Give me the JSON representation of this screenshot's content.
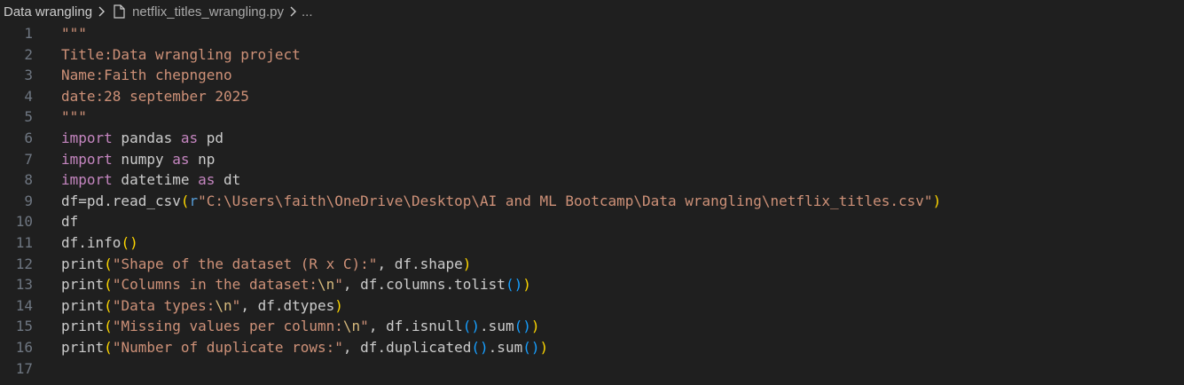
{
  "breadcrumb": {
    "folder": "Data wrangling",
    "file": "netflix_titles_wrangling.py",
    "more": "..."
  },
  "editor": {
    "lines": [
      {
        "num": "1",
        "tokens": [
          {
            "t": "\"\"\"",
            "c": "str"
          }
        ]
      },
      {
        "num": "2",
        "tokens": [
          {
            "t": "Title:Data wrangling project",
            "c": "str"
          }
        ]
      },
      {
        "num": "3",
        "tokens": [
          {
            "t": "Name:Faith chepngeno",
            "c": "str"
          }
        ]
      },
      {
        "num": "4",
        "tokens": [
          {
            "t": "date:28 september 2025",
            "c": "str"
          }
        ]
      },
      {
        "num": "5",
        "tokens": [
          {
            "t": "\"\"\"",
            "c": "str"
          }
        ]
      },
      {
        "num": "6",
        "tokens": [
          {
            "t": "import",
            "c": "kw"
          },
          {
            "t": " pandas ",
            "c": "id"
          },
          {
            "t": "as",
            "c": "kw"
          },
          {
            "t": " pd",
            "c": "id"
          }
        ]
      },
      {
        "num": "7",
        "tokens": [
          {
            "t": "import",
            "c": "kw"
          },
          {
            "t": " numpy ",
            "c": "id"
          },
          {
            "t": "as",
            "c": "kw"
          },
          {
            "t": " np",
            "c": "id"
          }
        ]
      },
      {
        "num": "8",
        "tokens": [
          {
            "t": "import",
            "c": "kw"
          },
          {
            "t": " datetime ",
            "c": "id"
          },
          {
            "t": "as",
            "c": "kw"
          },
          {
            "t": " dt",
            "c": "id"
          }
        ]
      },
      {
        "num": "9",
        "tokens": [
          {
            "t": "df=pd.read_csv",
            "c": "id"
          },
          {
            "t": "(",
            "c": "brY"
          },
          {
            "t": "r",
            "c": "pre"
          },
          {
            "t": "\"C:\\Users\\faith\\OneDrive\\Desktop\\AI and ML Bootcamp\\Data wrangling\\netflix_titles.csv\"",
            "c": "str"
          },
          {
            "t": ")",
            "c": "brY"
          }
        ]
      },
      {
        "num": "10",
        "tokens": [
          {
            "t": "df",
            "c": "id"
          }
        ]
      },
      {
        "num": "11",
        "tokens": [
          {
            "t": "df.info",
            "c": "id"
          },
          {
            "t": "()",
            "c": "brY"
          }
        ]
      },
      {
        "num": "12",
        "tokens": [
          {
            "t": "print",
            "c": "id"
          },
          {
            "t": "(",
            "c": "brY"
          },
          {
            "t": "\"Shape of the dataset (R x C):\"",
            "c": "str"
          },
          {
            "t": ", df.shape",
            "c": "id"
          },
          {
            "t": ")",
            "c": "brY"
          }
        ]
      },
      {
        "num": "13",
        "tokens": [
          {
            "t": "print",
            "c": "id"
          },
          {
            "t": "(",
            "c": "brY"
          },
          {
            "t": "\"Columns in the dataset:",
            "c": "str"
          },
          {
            "t": "\\n",
            "c": "esc"
          },
          {
            "t": "\"",
            "c": "str"
          },
          {
            "t": ", df.columns.tolist",
            "c": "id"
          },
          {
            "t": "()",
            "c": "br2"
          },
          {
            "t": ")",
            "c": "brY"
          }
        ]
      },
      {
        "num": "14",
        "tokens": [
          {
            "t": "print",
            "c": "id"
          },
          {
            "t": "(",
            "c": "brY"
          },
          {
            "t": "\"Data types:",
            "c": "str"
          },
          {
            "t": "\\n",
            "c": "esc"
          },
          {
            "t": "\"",
            "c": "str"
          },
          {
            "t": ", df.dtypes",
            "c": "id"
          },
          {
            "t": ")",
            "c": "brY"
          }
        ]
      },
      {
        "num": "15",
        "tokens": [
          {
            "t": "print",
            "c": "id"
          },
          {
            "t": "(",
            "c": "brY"
          },
          {
            "t": "\"Missing values per column:",
            "c": "str"
          },
          {
            "t": "\\n",
            "c": "esc"
          },
          {
            "t": "\"",
            "c": "str"
          },
          {
            "t": ", df.isnull",
            "c": "id"
          },
          {
            "t": "()",
            "c": "br2"
          },
          {
            "t": ".sum",
            "c": "id"
          },
          {
            "t": "()",
            "c": "br2"
          },
          {
            "t": ")",
            "c": "brY"
          }
        ]
      },
      {
        "num": "16",
        "tokens": [
          {
            "t": "print",
            "c": "id"
          },
          {
            "t": "(",
            "c": "brY"
          },
          {
            "t": "\"Number of duplicate rows:\"",
            "c": "str"
          },
          {
            "t": ", df.duplicated",
            "c": "id"
          },
          {
            "t": "()",
            "c": "br2"
          },
          {
            "t": ".sum",
            "c": "id"
          },
          {
            "t": "()",
            "c": "br2"
          },
          {
            "t": ")",
            "c": "brY"
          }
        ]
      },
      {
        "num": "17",
        "tokens": []
      }
    ]
  },
  "colors": {
    "background": "#1f1f1f",
    "string": "#ce9178",
    "keyword": "#c586c0",
    "identifier": "#cccccc",
    "line_number": "#6e7681",
    "bracket_outer": "#ffd700",
    "bracket_inner": "#179fff"
  },
  "icons": {
    "separator": "chevron-right-icon",
    "file": "file-icon"
  }
}
